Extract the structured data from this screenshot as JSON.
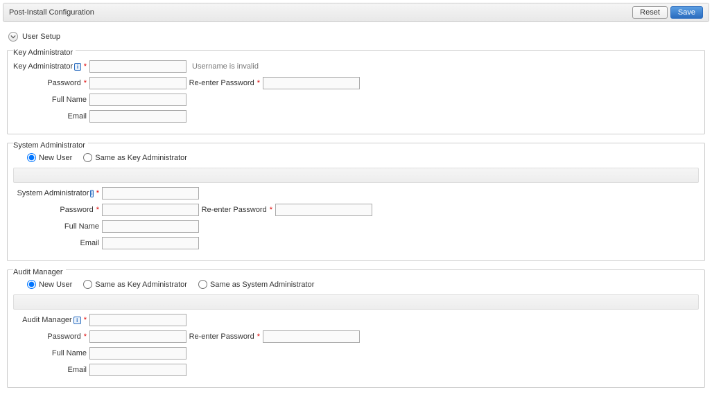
{
  "header": {
    "title": "Post-Install Configuration",
    "reset_label": "Reset",
    "save_label": "Save"
  },
  "section": {
    "title": "User Setup"
  },
  "keyAdmin": {
    "legend": "Key Administrator",
    "username_label": "Key Administrator",
    "username_value": "",
    "username_validation": "Username is invalid",
    "password_label": "Password",
    "password_value": "",
    "reenter_label": "Re-enter Password",
    "reenter_value": "",
    "fullname_label": "Full Name",
    "fullname_value": "",
    "email_label": "Email",
    "email_value": ""
  },
  "sysAdmin": {
    "legend": "System Administrator",
    "radio_new_label": "New User",
    "radio_same_key_label": "Same as Key Administrator",
    "radio_selected": "new",
    "username_label": "System Administrator",
    "username_value": "",
    "password_label": "Password",
    "password_value": "",
    "reenter_label": "Re-enter Password",
    "reenter_value": "",
    "fullname_label": "Full Name",
    "fullname_value": "",
    "email_label": "Email",
    "email_value": ""
  },
  "auditMgr": {
    "legend": "Audit Manager",
    "radio_new_label": "New User",
    "radio_same_key_label": "Same as Key Administrator",
    "radio_same_sys_label": "Same as System Administrator",
    "radio_selected": "new",
    "username_label": "Audit Manager",
    "username_value": "",
    "password_label": "Password",
    "password_value": "",
    "reenter_label": "Re-enter Password",
    "reenter_value": "",
    "fullname_label": "Full Name",
    "fullname_value": "",
    "email_label": "Email",
    "email_value": ""
  }
}
